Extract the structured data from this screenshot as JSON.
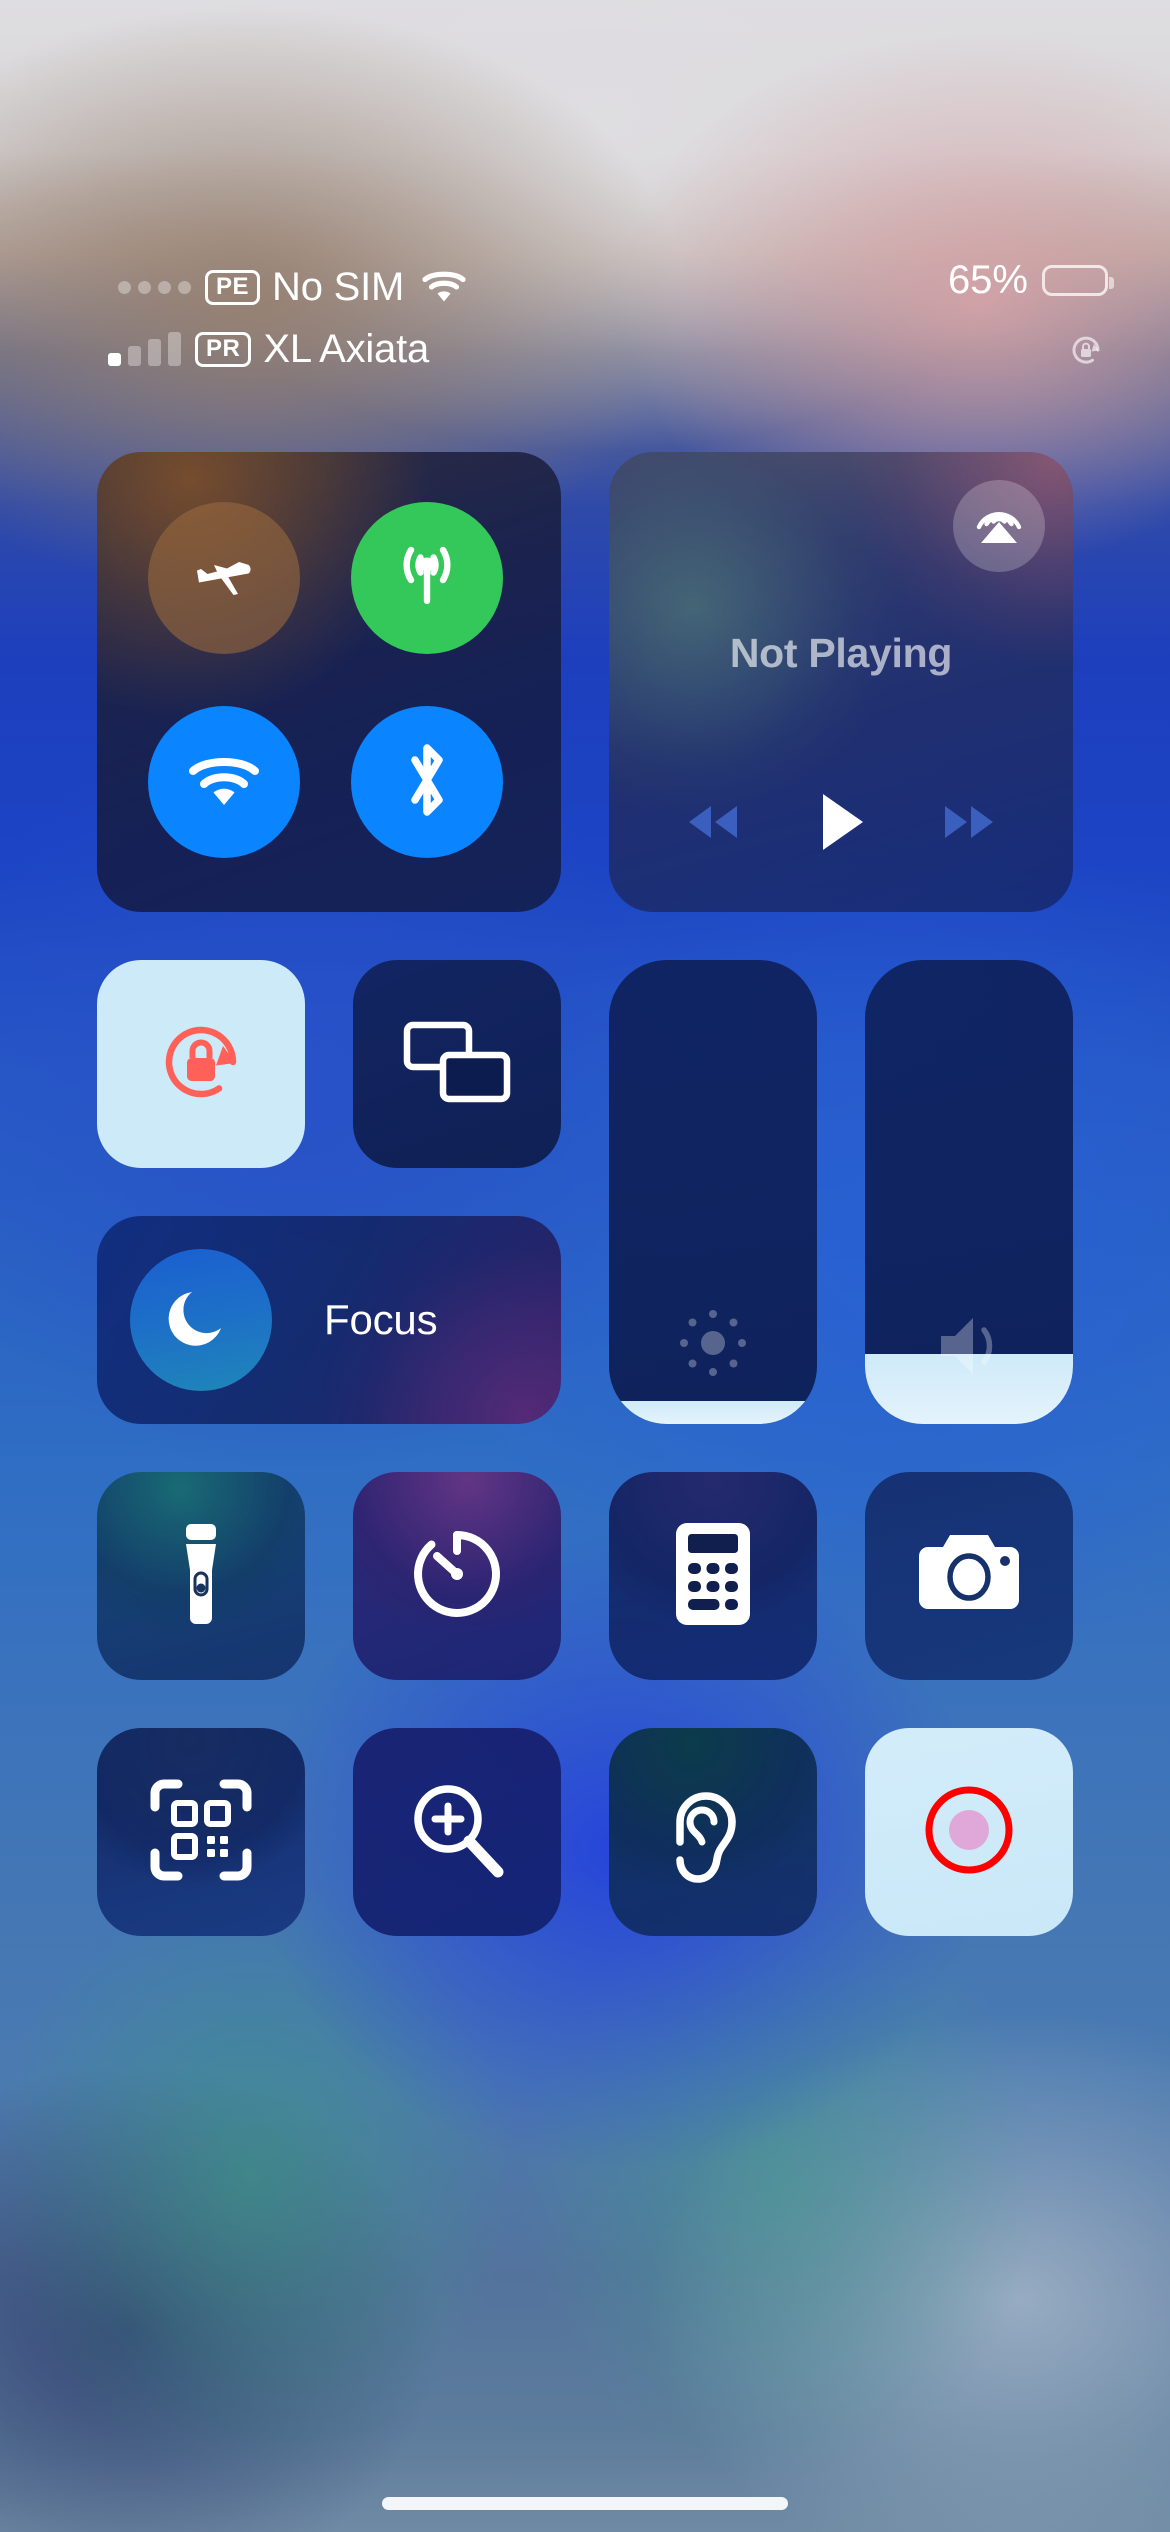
{
  "status_bar": {
    "line1": {
      "carrier_tag": "PE",
      "carrier_name": "No SIM",
      "signal_bars": 0,
      "wifi_icon": "wifi-icon"
    },
    "line2": {
      "carrier_tag": "PR",
      "carrier_name": "XL Axiata",
      "signal_bars": 1
    },
    "battery": {
      "percent_label": "65%",
      "level": 65
    },
    "rotation_lock_icon": "rotation-lock-icon"
  },
  "connectivity": {
    "airplane": {
      "name": "Airplane Mode",
      "icon": "airplane-icon",
      "active": false,
      "color": "#96673e"
    },
    "cellular": {
      "name": "Cellular Data",
      "icon": "cellular-antenna-icon",
      "active": true,
      "color": "#34c759"
    },
    "wifi": {
      "name": "Wi-Fi",
      "icon": "wifi-icon",
      "active": true,
      "color": "#0a84ff"
    },
    "bluetooth": {
      "name": "Bluetooth",
      "icon": "bluetooth-icon",
      "active": true,
      "color": "#0a84ff"
    }
  },
  "media": {
    "now_playing_label": "Not Playing",
    "airplay_icon": "airplay-icon",
    "controls": {
      "rewind_icon": "rewind-icon",
      "play_icon": "play-icon",
      "forward_icon": "forward-icon"
    },
    "control_color": "#3b5fbe"
  },
  "tiles": {
    "rotation_lock": {
      "name": "Rotation Lock",
      "icon": "rotation-lock-icon",
      "active": true,
      "bg": "#cdeaf8",
      "icon_color": "#ff6058"
    },
    "screen_mirroring": {
      "name": "Screen Mirroring",
      "icon": "screen-mirroring-icon",
      "active": false
    },
    "focus": {
      "label": "Focus",
      "icon": "moon-icon",
      "active": false
    }
  },
  "sliders": {
    "brightness": {
      "name": "Brightness",
      "icon": "brightness-icon",
      "value": 5
    },
    "volume": {
      "name": "Volume",
      "icon": "speaker-icon",
      "value": 15
    }
  },
  "shortcuts_row_1": [
    {
      "name": "Flashlight",
      "icon": "flashlight-icon",
      "id": "t-flashlight",
      "active": false
    },
    {
      "name": "Timer",
      "icon": "timer-icon",
      "id": "t-timer",
      "active": false
    },
    {
      "name": "Calculator",
      "icon": "calculator-icon",
      "id": "t-calculator",
      "active": false
    },
    {
      "name": "Camera",
      "icon": "camera-icon",
      "id": "t-camera",
      "active": false
    }
  ],
  "shortcuts_row_2": [
    {
      "name": "Code Scanner",
      "icon": "qr-code-icon",
      "id": "t-qrcode",
      "active": false
    },
    {
      "name": "Magnifier",
      "icon": "magnifier-icon",
      "id": "t-magnifier",
      "active": false
    },
    {
      "name": "Hearing",
      "icon": "ear-icon",
      "id": "t-hearing",
      "active": false
    },
    {
      "name": "Screen Recording",
      "icon": "record-icon",
      "id": "t-screenrecord",
      "active": true,
      "ring_color": "#ff0000",
      "dot_color": "#e0a8d8"
    }
  ],
  "home_indicator": {
    "name": "home-indicator"
  }
}
